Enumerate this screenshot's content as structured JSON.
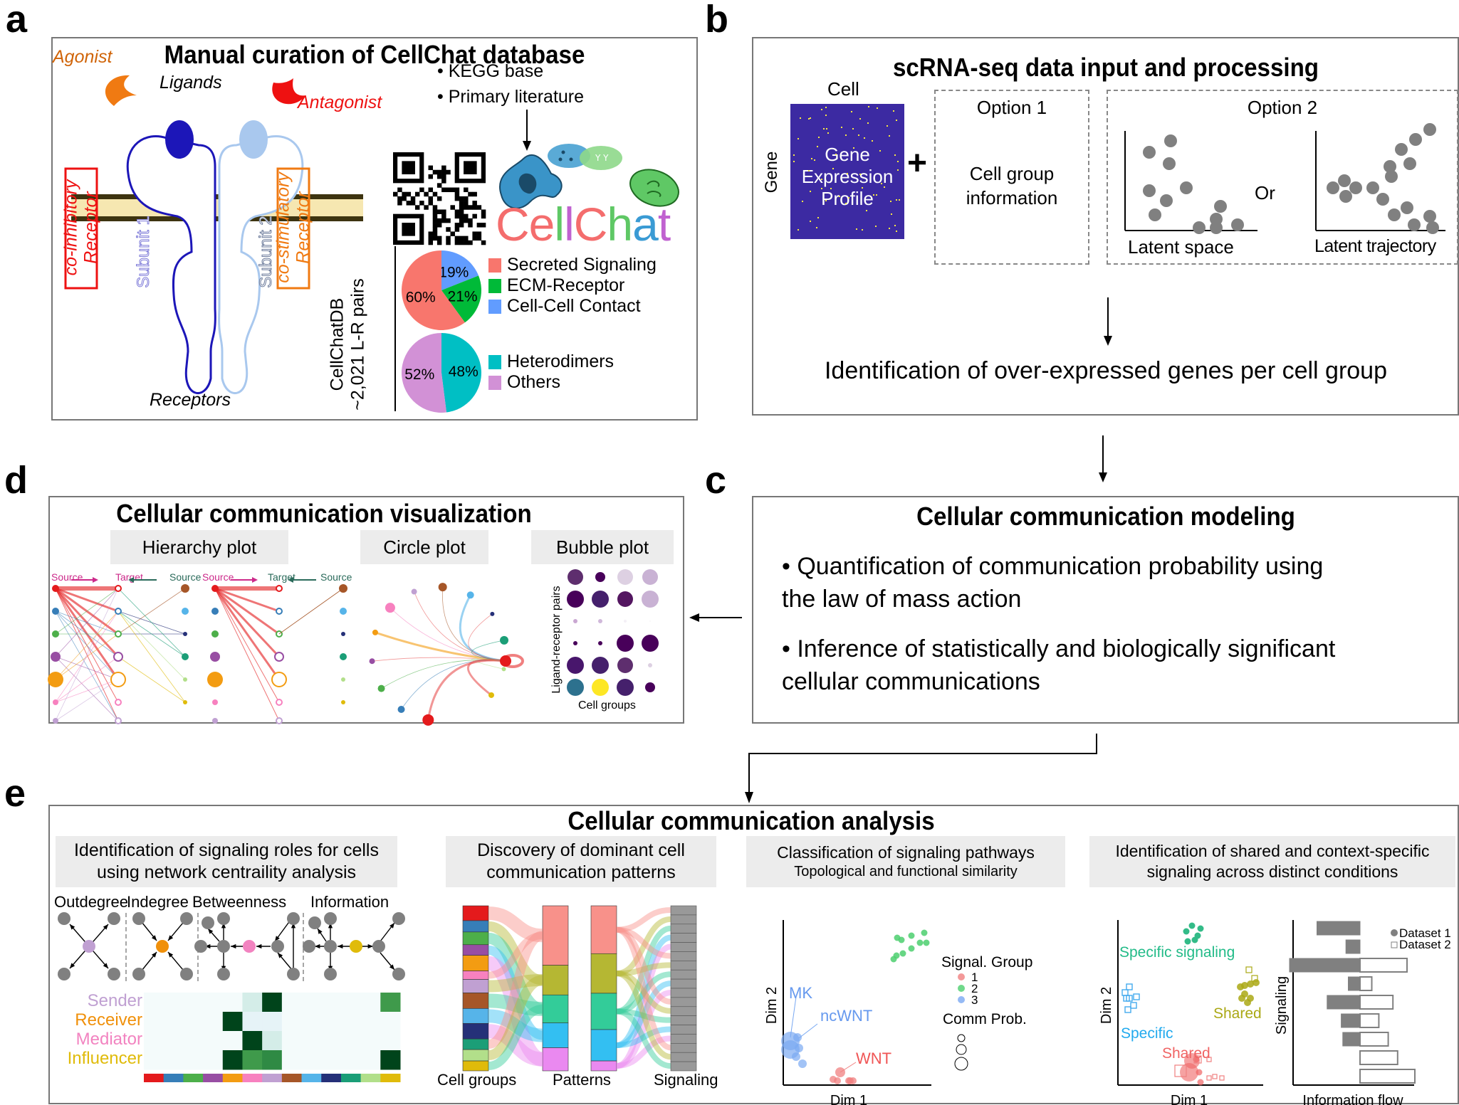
{
  "panels": {
    "a": {
      "letter": "a",
      "title": "Manual curation of CellChat database",
      "labels": {
        "agonist": "Agonist",
        "ligands": "Ligands",
        "antagonist": "Antagonist",
        "co_inhibitory_1": "co-inhibitory",
        "co_inhibitory_2": "Receptor",
        "co_stimulatory_1": "co-stimulatory",
        "co_stimulatory_2": "Receptor",
        "subunit1": "Subunit 1",
        "subunit2": "Subunit 2",
        "receptors": "Receptors"
      },
      "sources": [
        "• KEGG base",
        "• Primary literature"
      ],
      "logo_text": [
        "C",
        "e",
        "l",
        "l",
        "C",
        "h",
        "a",
        "t"
      ],
      "logo_colors": [
        "#f46d6d",
        "#f46d6d",
        "#5fc865",
        "#c062d0",
        "#f46d6d",
        "#5fc865",
        "#3a9bd4",
        "#c062d0"
      ],
      "db_label_1": "CellChatDB",
      "db_label_2": "~2,021 L-R pairs",
      "colors": {
        "agonist": "#f07a12",
        "antagonist": "#ee1111",
        "subunit1": "#1c16b8",
        "subunit2": "#a9c8ee",
        "inhibitory": "#ee1111",
        "stimulatory": "#f07a12",
        "membrane": "#f6e7b1",
        "membrane_edge": "#3d3410"
      }
    },
    "b": {
      "letter": "b",
      "title": "scRNA-seq data input and processing",
      "cell_label": "Cell",
      "gene_label": "Gene",
      "matrix_text": [
        "Gene",
        "Expression",
        "Profile"
      ],
      "matrix_color": "#3c2aa2",
      "plus": "+",
      "option1_title": "Option 1",
      "option1_text": [
        "Cell group",
        "information"
      ],
      "option2_title": "Option 2",
      "or_label": "Or",
      "latent_space_label": "Latent space",
      "latent_trajectory_label": "Latent trajectory",
      "result": "Identification of over-expressed genes per cell group"
    },
    "c": {
      "letter": "c",
      "title": "Cellular communication modeling",
      "bullets": [
        [
          "• Quantification of communication probability using",
          "the law of mass action"
        ],
        [
          "• Inference of statistically and biologically significant",
          "cellular communications"
        ]
      ]
    },
    "d": {
      "letter": "d",
      "title": "Cellular communication visualization",
      "subplots": [
        "Hierarchy plot",
        "Circle plot",
        "Bubble plot"
      ],
      "hierarchy_labels": [
        "Source",
        "Target",
        "Source",
        "Source",
        "Target",
        "Source"
      ],
      "bubble_ylabel": "Ligand-receptor pairs",
      "bubble_xlabel": "Cell groups"
    },
    "e": {
      "letter": "e",
      "title": "Cellular communication analysis",
      "sections": [
        {
          "title": [
            "Identification of signaling roles for cells",
            "using network centraility analysis"
          ]
        },
        {
          "title": [
            "Discovery of dominant cell",
            "communication patterns"
          ]
        },
        {
          "title": [
            "Classification of signaling pathways",
            "Topological and functional similarity"
          ]
        },
        {
          "title": [
            "Identification of shared and context-specific",
            "signaling across distinct conditions"
          ]
        }
      ],
      "centrality": [
        "Outdegree",
        "Indegree",
        "Betweenness",
        "Information"
      ],
      "roles": [
        {
          "label": "Sender",
          "color": "#c0a0d2"
        },
        {
          "label": "Receiver",
          "color": "#f0900a"
        },
        {
          "label": "Mediator",
          "color": "#f283c0"
        },
        {
          "label": "Influencer",
          "color": "#e0bb0a"
        }
      ],
      "heatmap_values": [
        [
          0,
          0,
          0,
          0,
          0,
          0.2,
          1,
          0,
          0,
          0,
          0,
          0,
          0.6
        ],
        [
          0,
          0,
          0,
          0,
          1,
          0.05,
          0.05,
          0,
          0,
          0,
          0,
          0,
          0
        ],
        [
          0,
          0,
          0,
          0,
          0,
          1,
          0.2,
          0,
          0,
          0,
          0,
          0,
          0
        ],
        [
          0,
          0,
          0,
          0,
          0.95,
          0.7,
          0.9,
          0,
          0,
          0,
          0,
          0,
          1
        ]
      ],
      "cell_group_colors": [
        "#e41a1c",
        "#377eb8",
        "#4daf4a",
        "#984ea3",
        "#f39c12",
        "#f781bf",
        "#c0a0d2",
        "#a65628",
        "#56b4e9",
        "#253078",
        "#1b9e77",
        "#b2df8a",
        "#e0bb0a"
      ],
      "pattern_labels": [
        "Cell groups",
        "Patterns",
        "Signaling"
      ],
      "pattern_colors": [
        "#f8918a",
        "#b5b733",
        "#33cc99",
        "#33bff2",
        "#ea89f0"
      ],
      "scatter1": {
        "xlabel": "Dim 1",
        "ylabel": "Dim 2",
        "legend_title": "Signal. Group",
        "groups": [
          "1",
          "2",
          "3"
        ],
        "group_colors": [
          "#f08080",
          "#4ccf6e",
          "#7aa9f2"
        ],
        "size_title": "Comm Prob.",
        "annotations": [
          {
            "text": "MK",
            "color": "#6699ee"
          },
          {
            "text": "ncWNT",
            "color": "#6699ee"
          },
          {
            "text": "WNT",
            "color": "#f05555"
          }
        ]
      },
      "scatter2": {
        "xlabel": "Dim 1",
        "ylabel": "Dim 2",
        "annotations": [
          {
            "text": "Specific signaling",
            "color": "#22bb88"
          },
          {
            "text": "Shared",
            "color": "#aaa814"
          },
          {
            "text": "Specific",
            "color": "#22aaee"
          },
          {
            "text": "Shared",
            "color": "#f06464"
          }
        ]
      },
      "infoflow": {
        "xlabel": "Information flow",
        "ylabel": "Signaling",
        "legend": [
          "Dataset 1",
          "Dataset 2"
        ],
        "bars": [
          {
            "d1": 0.55,
            "d2": 0
          },
          {
            "d1": 0.18,
            "d2": 0
          },
          {
            "d1": 0.9,
            "d2": 0.6
          },
          {
            "d1": 0.15,
            "d2": 0.15
          },
          {
            "d1": 0.42,
            "d2": 0.42
          },
          {
            "d1": 0.24,
            "d2": 0.24
          },
          {
            "d1": 0.22,
            "d2": 0.36
          },
          {
            "d1": 0.0,
            "d2": 0.48
          },
          {
            "d1": 0.0,
            "d2": 0.7
          }
        ]
      }
    }
  },
  "chart_data": [
    {
      "type": "pie",
      "title": "CellChatDB ~2,021 L-R pairs (interaction category)",
      "categories": [
        "Secreted Signaling",
        "ECM-Receptor",
        "Cell-Cell Contact"
      ],
      "values": [
        60,
        21,
        19
      ],
      "colors": [
        "#f8766d",
        "#00ba38",
        "#619cff"
      ],
      "labels": [
        "60%",
        "21%",
        "19%"
      ]
    },
    {
      "type": "pie",
      "title": "CellChatDB ~2,021 L-R pairs (complex type)",
      "categories": [
        "Heterodimers",
        "Others"
      ],
      "values": [
        48,
        52
      ],
      "colors": [
        "#00bfc4",
        "#d291d6"
      ],
      "labels": [
        "48%",
        "52%"
      ]
    }
  ]
}
